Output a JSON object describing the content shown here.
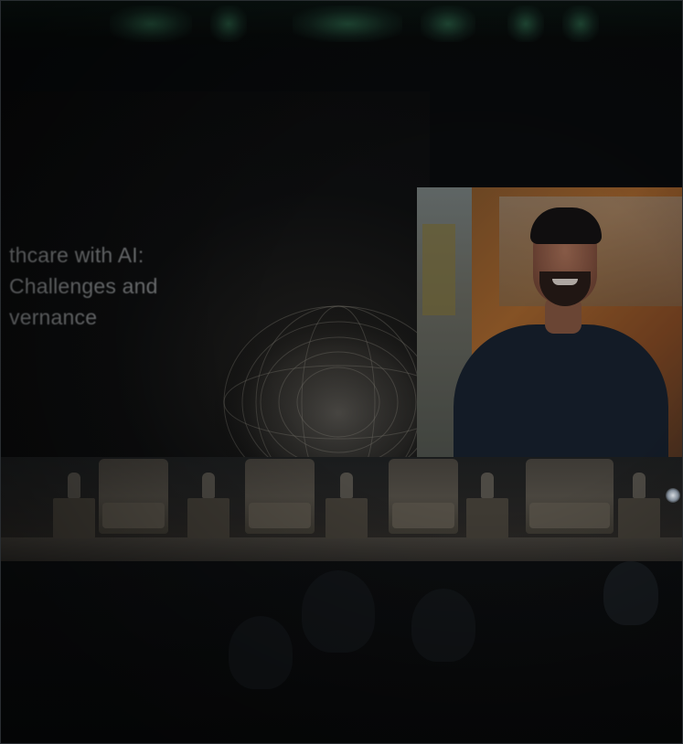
{
  "photo": {
    "subject": "conference stage",
    "slide_title_lines": [
      "thcare with AI:",
      "Challenges and",
      "vernance"
    ]
  },
  "colors": {
    "ceiling_light": "#3c8c64",
    "video_orange": "#b06b2c",
    "stage": "#2b2824"
  }
}
